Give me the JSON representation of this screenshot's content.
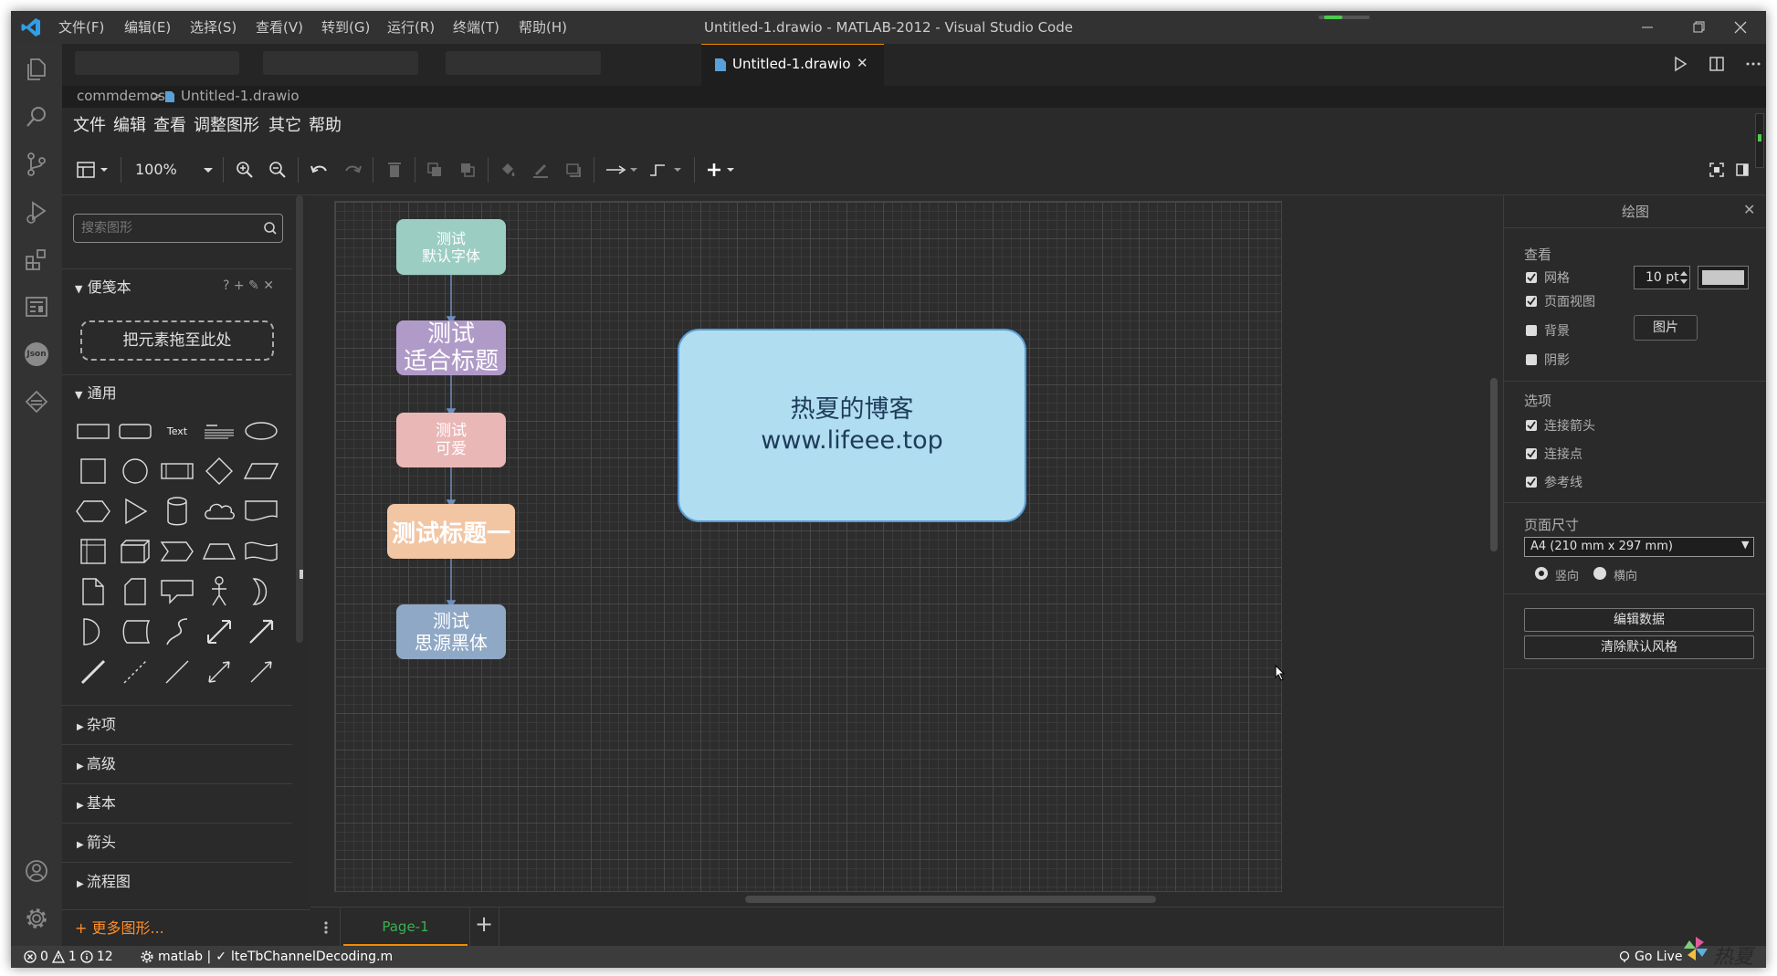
{
  "titlebar": {
    "menus": [
      "文件(F)",
      "编辑(E)",
      "选择(S)",
      "查看(V)",
      "转到(G)",
      "运行(R)",
      "终端(T)",
      "帮助(H)"
    ],
    "title": "Untitled-1.drawio - MATLAB-2012 - Visual Studio Code"
  },
  "activity_bar": [
    "explorer-icon",
    "search-icon",
    "source-control-icon",
    "run-debug-icon",
    "extensions-icon",
    "drawio-icon",
    "json-icon",
    "remote-icon",
    "account-icon",
    "settings-icon"
  ],
  "tabs": {
    "active": {
      "label": "Untitled-1.drawio",
      "close": "✕"
    }
  },
  "breadcrumb": {
    "folder": "commdemos",
    "sep": ">",
    "file": "Untitled-1.drawio"
  },
  "drawio_menu": [
    "文件",
    "编辑",
    "查看",
    "调整图形",
    "其它",
    "帮助"
  ],
  "toolbar": {
    "zoom": "100%"
  },
  "sidebar": {
    "search_placeholder": "搜索图形",
    "scratchpad": {
      "title": "便笺本",
      "actions": "? + ✎ ✕",
      "drop_text": "把元素拖至此处"
    },
    "general": "通用",
    "text_shape": "Text",
    "sections": [
      "杂项",
      "高级",
      "基本",
      "箭头",
      "流程图"
    ],
    "more": "+ 更多图形..."
  },
  "diagram": {
    "nodes": [
      {
        "text": "测试\n默认字体",
        "fill": "#9ccdc2"
      },
      {
        "text": "测试\n适合标题",
        "fill": "#b09bc8"
      },
      {
        "text": "测试\n可爱",
        "fill": "#eab7b7"
      },
      {
        "text": "测试标题一",
        "fill": "#f2c5a3"
      },
      {
        "text": "测试\n思源黑体",
        "fill": "#8fa8c5"
      }
    ],
    "blog_box": {
      "line1": "热夏的博客",
      "line2": "www.lifeee.top",
      "fill": "#b1ddf0"
    }
  },
  "pagebar": {
    "page": "Page-1",
    "add": "+"
  },
  "format_panel": {
    "title": "绘图",
    "view": {
      "header": "查看",
      "grid": "网格",
      "grid_size": "10 pt",
      "page_view": "页面视图",
      "background": "背景",
      "image_btn": "图片",
      "shadow": "阴影"
    },
    "options": {
      "header": "选项",
      "connection_arrows": "连接箭头",
      "connection_points": "连接点",
      "guides": "参考线"
    },
    "paper": {
      "header": "页面尺寸",
      "size": "A4 (210 mm x 297 mm)",
      "portrait": "竖向",
      "landscape": "横向"
    },
    "edit_data": "编辑数据",
    "clear_style": "清除默认风格"
  },
  "statusbar": {
    "errors": "0",
    "warnings": "1",
    "infos": "12",
    "matlab": "matlab |",
    "file": "lteTbChannelDecoding.m",
    "golive": "Go Live",
    "watermark": "热夏"
  }
}
